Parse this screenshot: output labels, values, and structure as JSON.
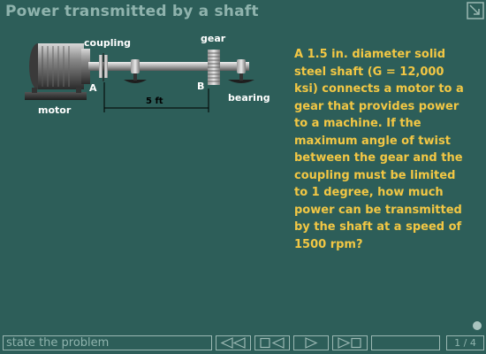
{
  "title": "Power transmitted by a shaft",
  "labels": {
    "coupling": "coupling",
    "gear": "gear",
    "point_a": "A",
    "point_b": "B",
    "bearing": "bearing",
    "motor": "motor",
    "length": "5 ft"
  },
  "problem_lines": [
    "A 1.5 in. diameter solid",
    "steel shaft (G = 12,000",
    "ksi) connects a motor to a",
    "gear that provides power",
    "to a machine.  If the",
    "maximum angle of twist",
    "between the gear and the",
    "coupling must be limited",
    "to 1 degree, how much",
    "power can be transmitted",
    "by the shaft at a speed of",
    "1500 rpm?"
  ],
  "nav": {
    "step_label": "state the problem",
    "page_current": "1",
    "page_total": "4",
    "icons": [
      "rewind-icon",
      "step-back-icon",
      "play-icon",
      "step-forward-icon"
    ]
  },
  "colors": {
    "background": "#2d5e59",
    "title": "#8fb3ad",
    "problem_text": "#f2c744"
  }
}
